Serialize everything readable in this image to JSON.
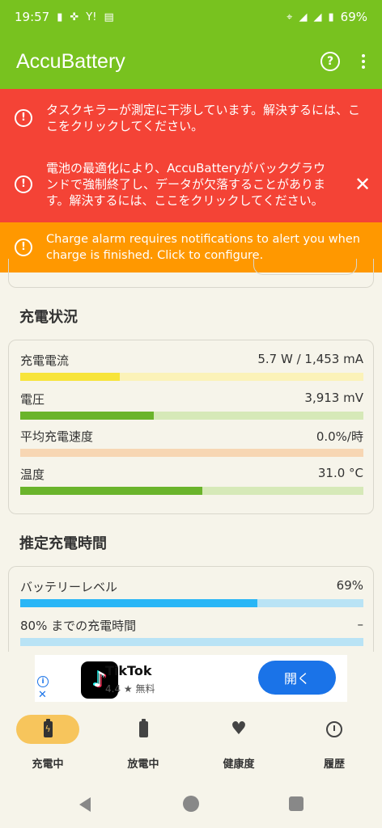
{
  "status_bar": {
    "time": "19:57",
    "battery_pct": "69%",
    "icons": [
      "battery-charging-icon",
      "sync-icon",
      "yahoo-icon",
      "news-icon",
      "location-icon",
      "wifi-icon",
      "signal-icon",
      "battery-icon"
    ]
  },
  "app_bar": {
    "title": "AccuBattery",
    "icons": [
      "help-icon",
      "more-vert-icon"
    ]
  },
  "banners": [
    {
      "text": "タスクキラーが測定に干渉しています。解決するには、ここをクリックしてください。",
      "color": "#f44336"
    },
    {
      "text": "電池の最適化により、AccuBatteryがバックグラウンドで強制終了し、データが欠落することがあります。解決するには、ここをクリックしてください。",
      "color": "#f44336"
    },
    {
      "text": "Charge alarm requires notifications to alert you when charge is finished. Click to configure.",
      "color": "#ff9800"
    }
  ],
  "charging_status": {
    "title": "充電状況",
    "rows": [
      {
        "label": "充電電流",
        "value": "5.7 W / 1,453 mA",
        "fill": 0.29,
        "color": "#f7e43a",
        "track": "#fbf2b8"
      },
      {
        "label": "電圧",
        "value": "3,913 mV",
        "fill": 0.39,
        "color": "#6ab42b",
        "track": "#d6e9b8"
      },
      {
        "label": "平均充電速度",
        "value": "0.0%/時",
        "fill": 0.0,
        "color": "#f5a45a",
        "track": "#f7d6b3"
      },
      {
        "label": "温度",
        "value": "31.0 °C",
        "fill": 0.53,
        "color": "#6ab42b",
        "track": "#d6e9b8"
      }
    ]
  },
  "estimated_time": {
    "title": "推定充電時間",
    "rows": [
      {
        "label": "バッテリーレベル",
        "value": "69%",
        "fill": 0.69,
        "color": "#29b6f6",
        "track": "#b9e3f5"
      },
      {
        "label": "80% までの充電時間",
        "value": "–",
        "fill": 0.0,
        "color": "#29b6f6",
        "track": "#b9e3f5"
      }
    ]
  },
  "ad": {
    "app_name": "TikTok",
    "rating": "4.4 ★",
    "price": "無料",
    "button": "開く",
    "icons": [
      "ad-info-icon",
      "ad-close-icon",
      "tiktok-logo-icon"
    ]
  },
  "bottom_nav": {
    "items": [
      {
        "label": "充電中",
        "icon": "charging-icon",
        "active": true
      },
      {
        "label": "放電中",
        "icon": "discharging-icon",
        "active": false
      },
      {
        "label": "健康度",
        "icon": "heart-icon",
        "active": false
      },
      {
        "label": "履歴",
        "icon": "history-icon",
        "active": false
      }
    ]
  },
  "colors": {
    "brand_green": "#78c21f",
    "alert_red": "#f44336",
    "alert_orange": "#ff9800",
    "nav_active": "#f7c55c"
  }
}
